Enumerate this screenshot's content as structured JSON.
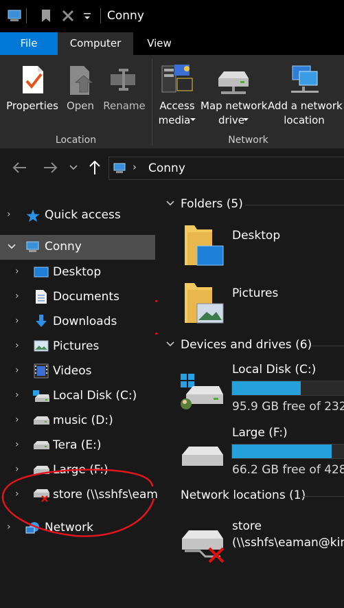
{
  "window": {
    "title": "Conny"
  },
  "ribbon": {
    "tabs": [
      "File",
      "Computer",
      "View"
    ],
    "buttons": {
      "properties": "Properties",
      "open": "Open",
      "rename": "Rename",
      "access_media": [
        "Access",
        "media"
      ],
      "map_network_drive": [
        "Map network",
        "drive"
      ],
      "add_network_location": [
        "Add a network",
        "location"
      ]
    },
    "groups": {
      "location": "Location",
      "network": "Network"
    }
  },
  "address": {
    "path": "Conny"
  },
  "nav": {
    "quick_access": "Quick access",
    "conny": "Conny",
    "children": [
      "Desktop",
      "Documents",
      "Downloads",
      "Pictures",
      "Videos",
      "Local Disk (C:)",
      "music (D:)",
      "Tera (E:)",
      "Large (F:)",
      "store (\\\\sshfs\\eama"
    ],
    "network": "Network"
  },
  "content": {
    "folders_header": "Folders (5)",
    "folders": [
      "Desktop",
      "Pictures"
    ],
    "devices_header": "Devices and drives (6)",
    "drives": [
      {
        "name": "Local Disk (C:)",
        "free_text": "95.9 GB free of 232 G",
        "used_fraction": 0.59
      },
      {
        "name": "Large (F:)",
        "free_text": "66.2 GB free of 428 G",
        "used_fraction": 0.85
      }
    ],
    "network_header": "Network locations (1)",
    "network_item": {
      "name": "store",
      "path": "(\\\\sshfs\\eaman@kim"
    }
  },
  "colors": {
    "accent": "#0078d7",
    "drive_bar": "#26a0da",
    "annotation": "#e0161d"
  }
}
